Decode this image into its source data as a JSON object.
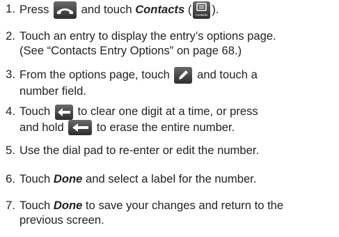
{
  "steps": [
    {
      "num": "1.",
      "t1": "Press",
      "t2": "and touch",
      "t3": "Contacts",
      "t4": "(",
      "t5": ").",
      "icon_phone": "phone-icon",
      "icon_contacts": "contacts-icon",
      "icon_contacts_label": "Contacts"
    },
    {
      "num": "2.",
      "l1": "Touch an entry to display the entry’s options page.",
      "l2": "(See “Contacts Entry Options” on page 68.)"
    },
    {
      "num": "3.",
      "t1": "From the options page, touch",
      "t2": "and touch a",
      "l2": "number field.",
      "icon_pencil": "pencil-icon"
    },
    {
      "num": "4.",
      "t1": "Touch",
      "t2": "to clear one digit at a time, or press",
      "l2a": "and hold",
      "l2b": "to erase the entire number.",
      "icon_back": "backspace-icon"
    },
    {
      "num": "5.",
      "l1": "Use the dial pad to re-enter or edit the number."
    },
    {
      "num": "6.",
      "t1": "Touch",
      "t2": "Done",
      "t3": "and select a label for the number."
    },
    {
      "num": "7.",
      "t1": "Touch",
      "t2": "Done",
      "t3": "to save your changes and return to the",
      "l2": "previous screen."
    }
  ]
}
